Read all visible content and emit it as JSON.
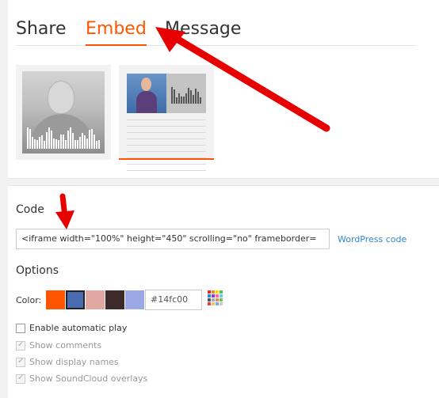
{
  "tabs": [
    {
      "label": "Share"
    },
    {
      "label": "Embed"
    },
    {
      "label": "Message"
    }
  ],
  "embed": {
    "code_title": "Code",
    "code_value": "<iframe width=\"100%\" height=\"450\" scrolling=\"no\" frameborder=",
    "wordpress_link": "WordPress code",
    "options_title": "Options",
    "color_label": "Color:",
    "color_value": "#14fc00",
    "swatches": [
      "#ff5500",
      "#4a6bb0",
      "#e0a8a0",
      "#3d2a2a",
      "#9aa8e4"
    ],
    "checkboxes": [
      {
        "label": "Enable automatic play",
        "checked": false,
        "disabled": false
      },
      {
        "label": "Show comments",
        "checked": true,
        "disabled": true
      },
      {
        "label": "Show display names",
        "checked": true,
        "disabled": true
      },
      {
        "label": "Show SoundCloud overlays",
        "checked": true,
        "disabled": true
      }
    ]
  },
  "colors": {
    "accent": "#ff5500",
    "link": "#3388cc",
    "arrow": "#e60000"
  }
}
